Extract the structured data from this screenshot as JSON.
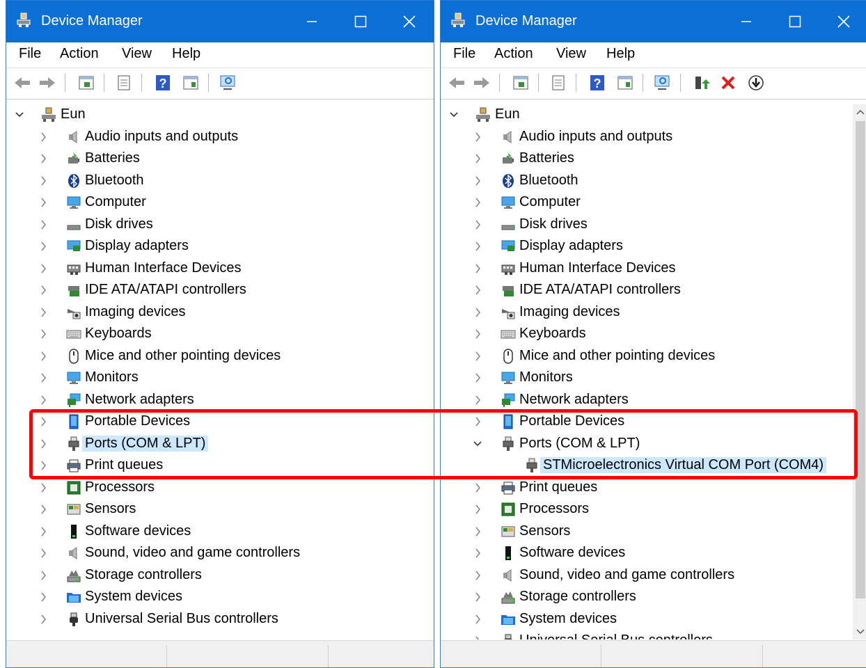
{
  "title": "Device Manager",
  "menu": [
    "File",
    "Action",
    "View",
    "Help"
  ],
  "root": "Eun",
  "left_items": [
    {
      "label": "Audio inputs and outputs",
      "icon": "speaker-icon"
    },
    {
      "label": "Batteries",
      "icon": "battery-icon"
    },
    {
      "label": "Bluetooth",
      "icon": "bluetooth-icon"
    },
    {
      "label": "Computer",
      "icon": "computer-icon"
    },
    {
      "label": "Disk drives",
      "icon": "disk-icon"
    },
    {
      "label": "Display adapters",
      "icon": "display-adapter-icon"
    },
    {
      "label": "Human Interface Devices",
      "icon": "hid-icon"
    },
    {
      "label": "IDE ATA/ATAPI controllers",
      "icon": "ide-icon"
    },
    {
      "label": "Imaging devices",
      "icon": "camera-icon"
    },
    {
      "label": "Keyboards",
      "icon": "keyboard-icon"
    },
    {
      "label": "Mice and other pointing devices",
      "icon": "mouse-icon"
    },
    {
      "label": "Monitors",
      "icon": "monitor-icon"
    },
    {
      "label": "Network adapters",
      "icon": "network-icon"
    },
    {
      "label": "Portable Devices",
      "icon": "portable-device-icon"
    },
    {
      "label": "Ports (COM & LPT)",
      "icon": "port-icon"
    },
    {
      "label": "Print queues",
      "icon": "printer-icon"
    },
    {
      "label": "Processors",
      "icon": "processor-icon"
    },
    {
      "label": "Sensors",
      "icon": "sensor-icon"
    },
    {
      "label": "Software devices",
      "icon": "software-device-icon"
    },
    {
      "label": "Sound, video and game controllers",
      "icon": "speaker-icon"
    },
    {
      "label": "Storage controllers",
      "icon": "storage-icon"
    },
    {
      "label": "System devices",
      "icon": "system-folder-icon"
    },
    {
      "label": "Universal Serial Bus controllers",
      "icon": "usb-icon"
    }
  ],
  "right_items": [
    {
      "label": "Audio inputs and outputs",
      "icon": "speaker-icon"
    },
    {
      "label": "Batteries",
      "icon": "battery-icon"
    },
    {
      "label": "Bluetooth",
      "icon": "bluetooth-icon"
    },
    {
      "label": "Computer",
      "icon": "computer-icon"
    },
    {
      "label": "Disk drives",
      "icon": "disk-icon"
    },
    {
      "label": "Display adapters",
      "icon": "display-adapter-icon"
    },
    {
      "label": "Human Interface Devices",
      "icon": "hid-icon"
    },
    {
      "label": "IDE ATA/ATAPI controllers",
      "icon": "ide-icon"
    },
    {
      "label": "Imaging devices",
      "icon": "camera-icon"
    },
    {
      "label": "Keyboards",
      "icon": "keyboard-icon"
    },
    {
      "label": "Mice and other pointing devices",
      "icon": "mouse-icon"
    },
    {
      "label": "Monitors",
      "icon": "monitor-icon"
    },
    {
      "label": "Network adapters",
      "icon": "network-icon"
    },
    {
      "label": "Portable Devices",
      "icon": "portable-device-icon"
    },
    {
      "label": "Ports (COM & LPT)",
      "icon": "port-icon",
      "expanded": true
    },
    {
      "label": "STMicroelectronics Virtual COM Port (COM4)",
      "icon": "port-icon",
      "child": true
    },
    {
      "label": "Print queues",
      "icon": "printer-icon"
    },
    {
      "label": "Processors",
      "icon": "processor-icon"
    },
    {
      "label": "Sensors",
      "icon": "sensor-icon"
    },
    {
      "label": "Software devices",
      "icon": "software-device-icon"
    },
    {
      "label": "Sound, video and game controllers",
      "icon": "speaker-icon"
    },
    {
      "label": "Storage controllers",
      "icon": "storage-icon"
    },
    {
      "label": "System devices",
      "icon": "system-folder-icon"
    },
    {
      "label": "Universal Serial Bus controllers",
      "icon": "usb-icon"
    }
  ],
  "left_selected": "Ports (COM & LPT)",
  "right_selected": "STMicroelectronics Virtual COM Port (COM4)",
  "colors": {
    "titlebar": "#0b6fd6",
    "selection": "#cce8ff",
    "highlight": "#ff0000"
  }
}
